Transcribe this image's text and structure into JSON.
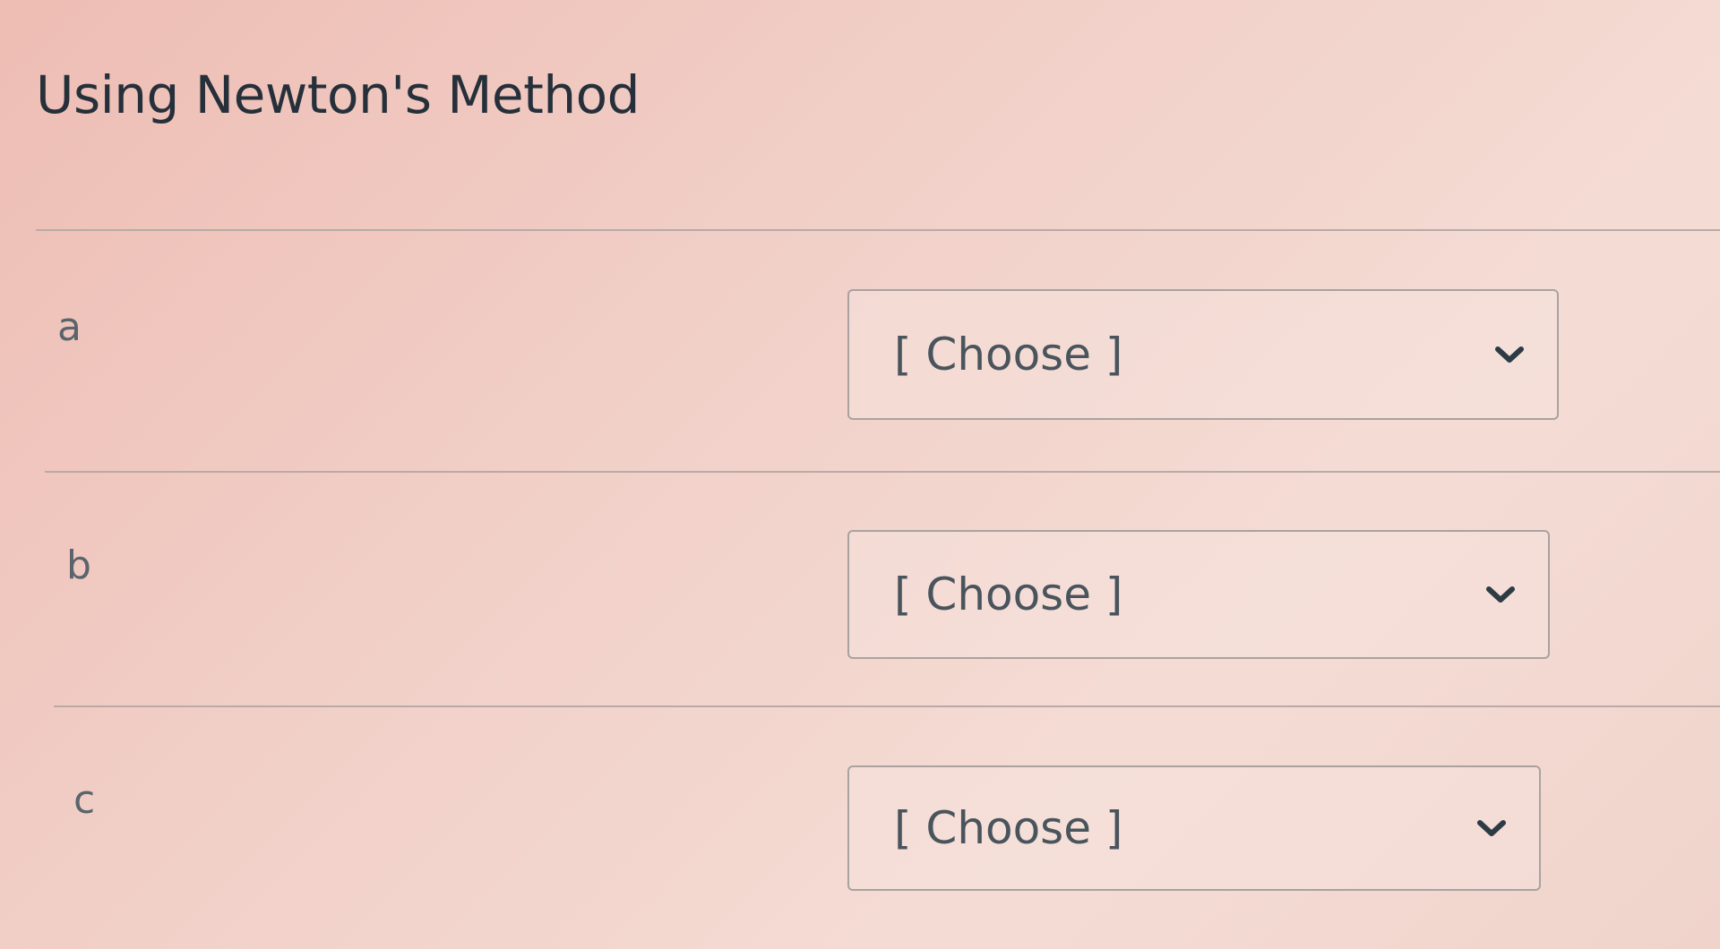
{
  "question": {
    "title": "Using Newton's Method",
    "rows": [
      {
        "label": "a",
        "selected": "[ Choose ]"
      },
      {
        "label": "b",
        "selected": "[ Choose ]"
      },
      {
        "label": "c",
        "selected": "[ Choose ]"
      }
    ]
  },
  "icons": {
    "dropdown": "chevron-down-icon"
  },
  "colors": {
    "background": "#f1d0c8",
    "text": "#26303a",
    "border": "#a9a2a0"
  }
}
